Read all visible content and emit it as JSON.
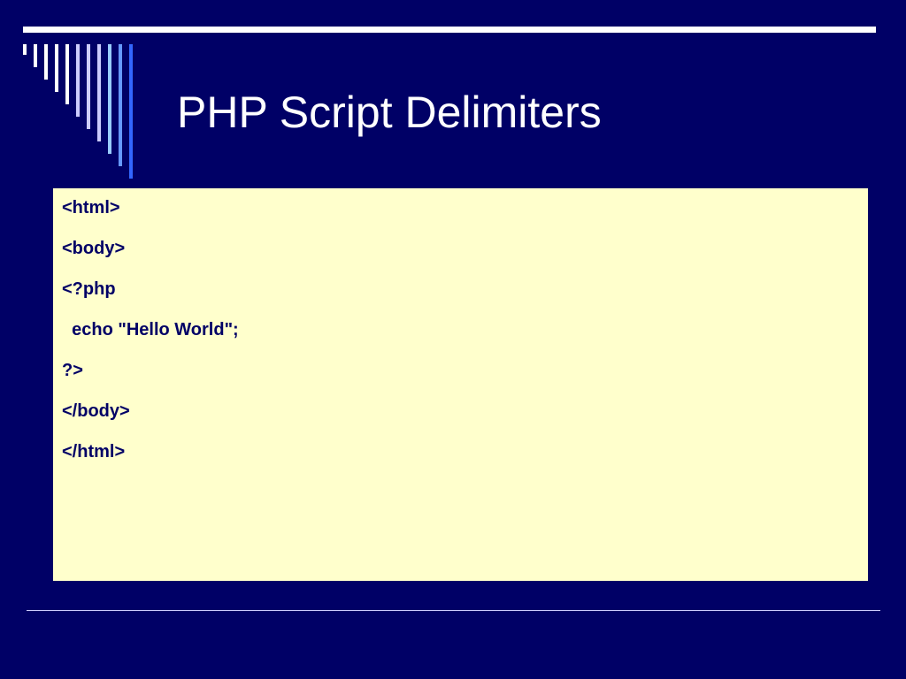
{
  "slide": {
    "title": "PHP Script Delimiters",
    "code_lines": [
      "<html>",
      "<body>",
      "<?php",
      "  echo \"Hello World\";",
      "?>",
      "</body>",
      "</html>"
    ]
  },
  "colors": {
    "background": "#000066",
    "title_text": "#ffffff",
    "code_background": "#ffffcc",
    "code_text": "#000066",
    "stripes": [
      "#ffffff",
      "#ffffff",
      "#ffffff",
      "#ffffff",
      "#ffffff",
      "#ccccff",
      "#ccccff",
      "#ccccff",
      "#99ccff",
      "#6699ff",
      "#3366ff"
    ]
  }
}
